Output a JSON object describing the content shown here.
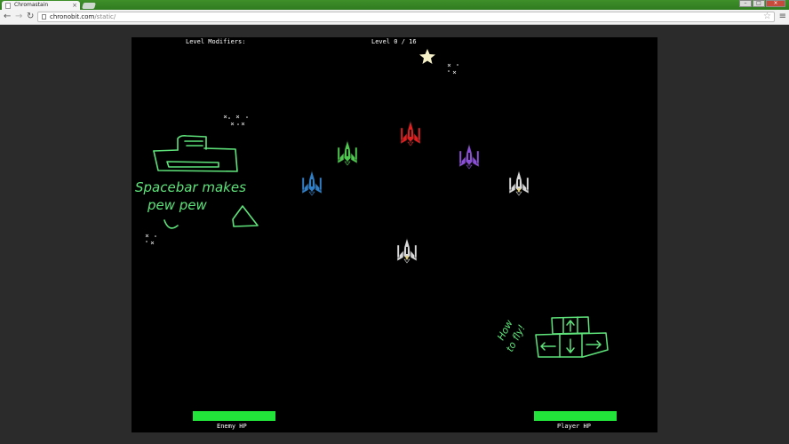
{
  "browser": {
    "tab_title": "Chromastain",
    "url_domain": "chronobit.com",
    "url_path": "/static/"
  },
  "game": {
    "level_modifiers_label": "Level Modifiers:",
    "level_label": "Level",
    "level_current": "0",
    "level_total": "16",
    "enemy_hp_label": "Enemy HP",
    "player_hp_label": "Player HP",
    "enemy_hp_fraction": 1.0,
    "player_hp_fraction": 1.0,
    "hp_color": "#22e33a",
    "doodle_color": "#5ee37a",
    "hint_fire": "Spacebar makes pew pew",
    "hint_fly": "How to fly!",
    "ships": [
      {
        "id": "enemy-red",
        "color": "#e02020"
      },
      {
        "id": "enemy-green",
        "color": "#4fc84f"
      },
      {
        "id": "enemy-purple",
        "color": "#8a4fd6"
      },
      {
        "id": "enemy-blue",
        "color": "#2f7fc8"
      },
      {
        "id": "enemy-white",
        "color": "#d8d8d8"
      },
      {
        "id": "player",
        "color": "#d8d8d8"
      }
    ]
  }
}
